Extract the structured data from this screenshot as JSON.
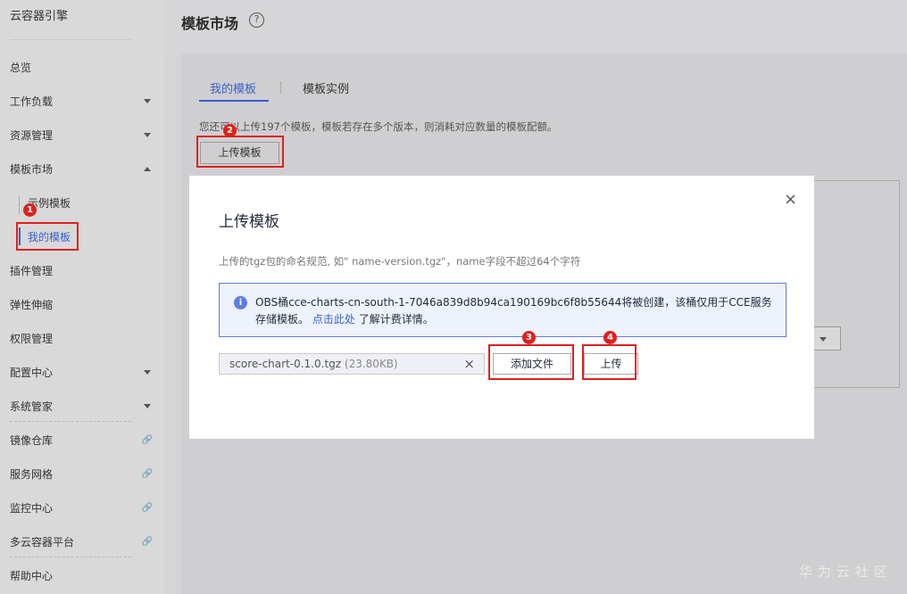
{
  "sidebar": {
    "title": "云容器引擎",
    "items": [
      {
        "label": "总览"
      },
      {
        "label": "工作负载"
      },
      {
        "label": "资源管理"
      },
      {
        "label": "模板市场"
      },
      {
        "label": "插件管理"
      },
      {
        "label": "弹性伸缩"
      },
      {
        "label": "权限管理"
      },
      {
        "label": "配置中心"
      },
      {
        "label": "系统管家"
      },
      {
        "label": "镜像仓库"
      },
      {
        "label": "服务网格"
      },
      {
        "label": "监控中心"
      },
      {
        "label": "多云容器平台"
      },
      {
        "label": "帮助中心"
      }
    ],
    "sub_items": [
      {
        "label": "示例模板"
      },
      {
        "label": "我的模板"
      }
    ]
  },
  "header": {
    "title": "模板市场",
    "help": "?"
  },
  "tabs": [
    {
      "label": "我的模板"
    },
    {
      "label": "模板实例"
    }
  ],
  "main": {
    "quota_text": "您还可以上传197个模板，模板若存在多个版本，则消耗对应数量的模板配额。",
    "upload_template_button": "上传模板"
  },
  "dialog": {
    "title": "上传模板",
    "close": "×",
    "hint": "上传的tgz包的命名规范, 如\" name-version.tgz\"，name字段不超过64个字符",
    "info_icon": "i",
    "info_text": "OBS桶cce-charts-cn-south-1-7046a839d8b94ca190169bc6f8b55644将被创建，该桶仅用于CCE服务存储模板。",
    "info_link": "点击此处",
    "info_suffix": "了解计费详情。",
    "file_name": "score-chart-0.1.0.tgz",
    "file_size": "(23.80KB)",
    "file_clear": "×",
    "add_file_button": "添加文件",
    "upload_button": "上传"
  },
  "markers": [
    "1",
    "2",
    "3",
    "4"
  ],
  "watermark": "华为云社区",
  "colors": {
    "accent": "#3a5fcd",
    "highlight": "#e0201a",
    "info_bg": "#edf2fc"
  }
}
